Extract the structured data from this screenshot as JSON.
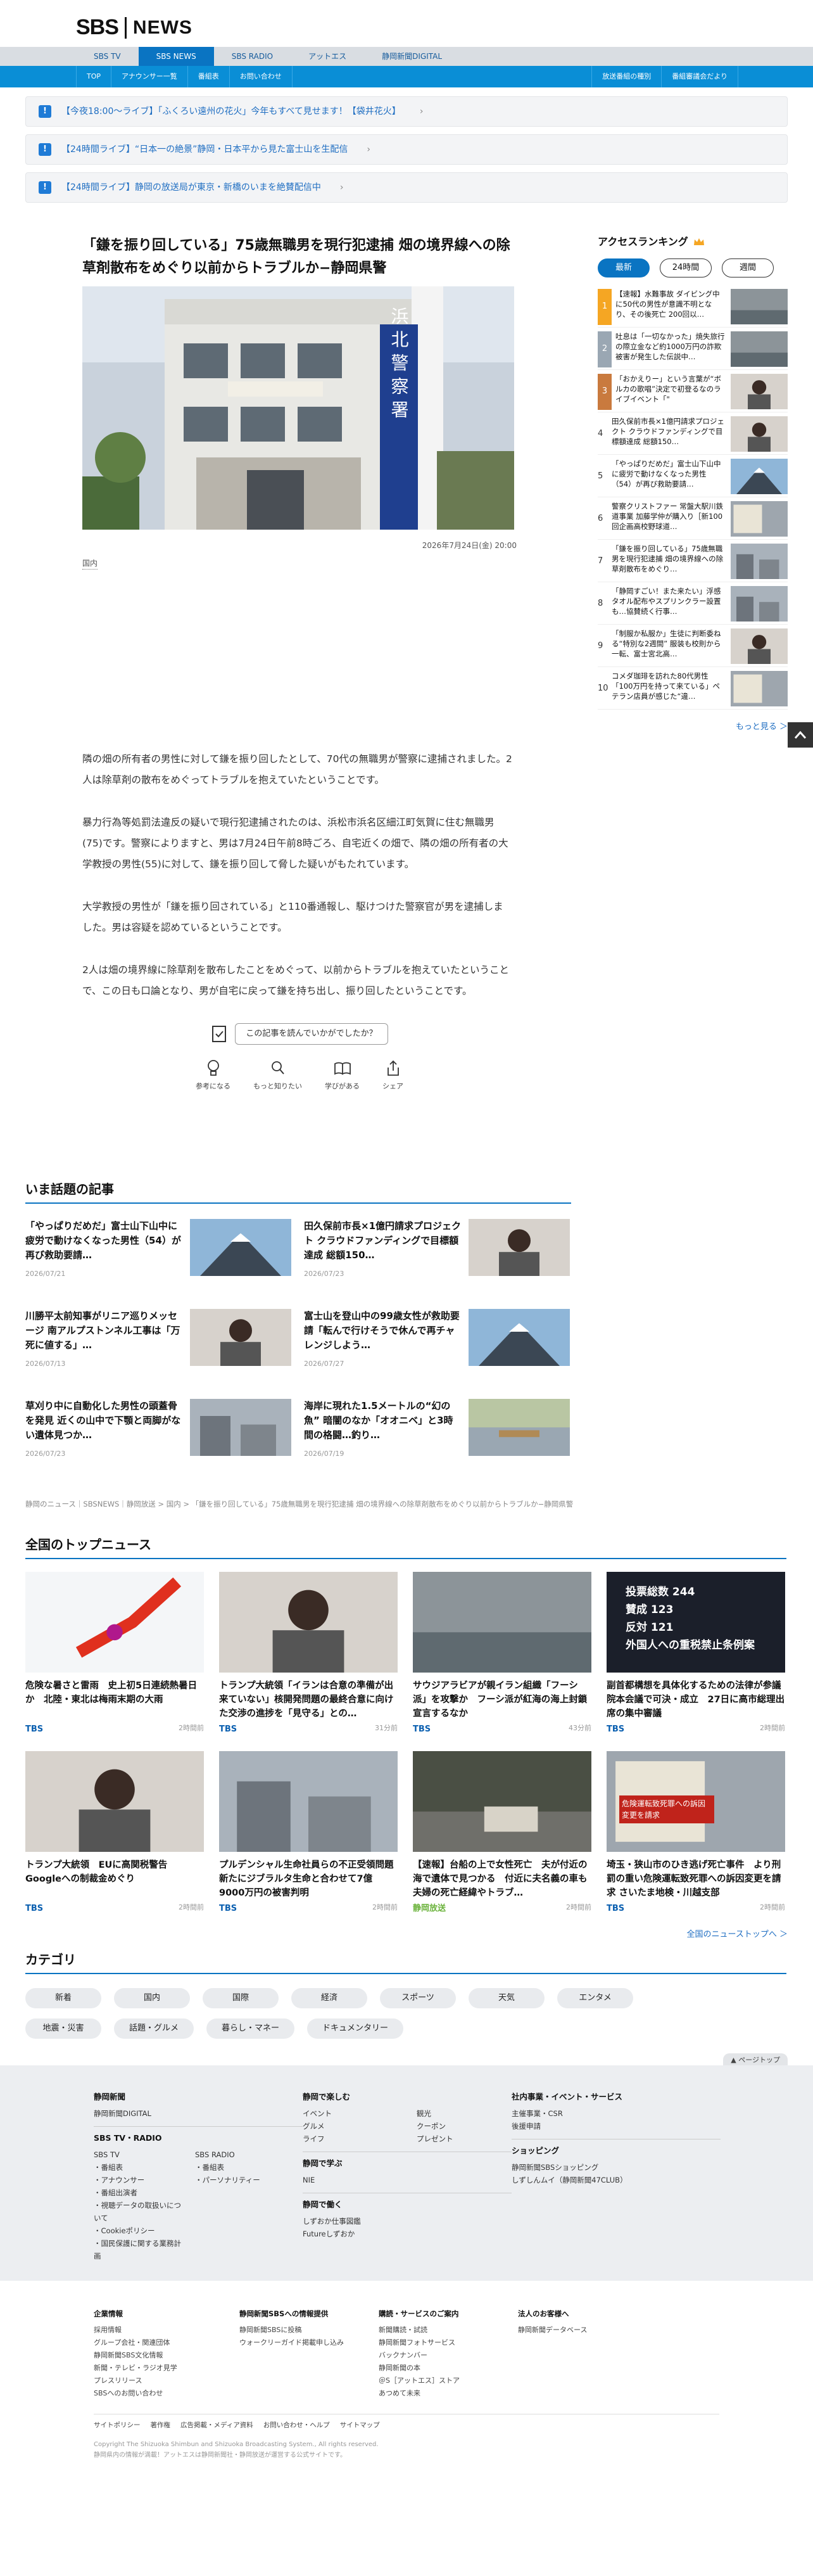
{
  "header": {
    "logo_sbs": "SBS",
    "logo_news": "NEWS"
  },
  "topnav": [
    "SBS TV",
    "SBS NEWS",
    "SBS RADIO",
    "アットエス",
    "静岡新聞DIGITAL"
  ],
  "subnav": {
    "left": [
      "TOP",
      "アナウンサー一覧",
      "番組表",
      "お問い合わせ"
    ],
    "right": [
      "放送番組の種別",
      "番組審議会だより"
    ]
  },
  "alerts": [
    "【今夜18:00〜ライブ】「ふくろい遠州の花火」今年もすべて見せます！【袋井花火】",
    "【24時間ライブ】“日本一の絶景”静岡・日本平から見た富士山を生配信",
    "【24時間ライブ】静岡の放送局が東京・新橋のいまを絶賛配信中"
  ],
  "article": {
    "title": "「鎌を振り回している」75歳無職男を現行犯逮捕 畑の境界線への除草剤散布をめぐり以前からトラブルか−静岡県警",
    "building_sign": "浜 北 警 察 署",
    "date": "2026年7月24日(金) 20:00",
    "category": "国内",
    "paragraphs": [
      "隣の畑の所有者の男性に対して鎌を振り回したとして、70代の無職男が警察に逮捕されました。2人は除草剤の散布をめぐってトラブルを抱えていたということです。",
      "暴力行為等処罰法違反の疑いで現行犯逮捕されたのは、浜松市浜名区細江町気賀に住む無職男(75)です。警察によりますと、男は7月24日午前8時ごろ、自宅近くの畑で、隣の畑の所有者の大学教授の男性(55)に対して、鎌を振り回して脅した疑いがもたれています。",
      "大学教授の男性が「鎌を振り回されている」と110番通報し、駆けつけた警察官が男を逮捕しました。男は容疑を認めているということです。",
      "2人は畑の境界線に除草剤を散布したことをめぐって、以前からトラブルを抱えていたということで、この日も口論となり、男が自宅に戻って鎌を持ち出し、振り回したということです。"
    ],
    "feedback_question": "この記事を読んでいかがでしたか？",
    "feedback_options": [
      "参考になる",
      "もっと知りたい",
      "学びがある",
      "シェア"
    ]
  },
  "ranking": {
    "title": "アクセスランキング",
    "tabs": [
      "最新",
      "24時間",
      "週間"
    ],
    "items": [
      {
        "num": "1",
        "text": "【速報】水難事故 ダイビング中に50代の男性が意識不明となり、その後死亡 200回以…"
      },
      {
        "num": "2",
        "text": "吐息は「一切なかった」焼失旅行の際立金など約1000万円の詐欺被害が発生した伝説中…"
      },
      {
        "num": "3",
        "text": "「おかえりー」という言葉が“ボルカの歌唱”決定で初登るなのライブイベント「\""
      },
      {
        "num": "4",
        "text": "田久保前市長×1億円請求プロジェクト クラウドファンディングで目標額達成 総額150…"
      },
      {
        "num": "5",
        "text": "「やっぱりだめだ」富士山下山中に疲労で動けなくなった男性（54）が再び救助要請…"
      },
      {
        "num": "6",
        "text": "警察クリストファー 常盤大駅川鉄道事業 加藤学仲が購入り［新100回企画高校野球道…"
      },
      {
        "num": "7",
        "text": "「鎌を振り回している」75歳無職男を現行犯逮捕 畑の境界線への除草剤散布をめぐり…"
      },
      {
        "num": "8",
        "text": "「静岡すごい！また来たい」浮感タオル配布やスプリンクラー設置も…協賛続く行事…"
      },
      {
        "num": "9",
        "text": "「制服か私服か」生徒に判断委ねる“特別な2週間” 服装も校則から一転、富士宮北高…"
      },
      {
        "num": "10",
        "text": "コメダ珈琲を訪れた80代男性「100万円を持って来ている」ペテラン店員が感じた“違…"
      }
    ],
    "more": "もっと見る ＞"
  },
  "trending": {
    "title": "いま話題の記事",
    "items": [
      {
        "title": "「やっぱりだめだ」富士山下山中に疲労で動けなくなった男性（54）が再び救助要請…",
        "date": "2026/07/21"
      },
      {
        "title": "田久保前市長×1億円請求プロジェクト クラウドファンディングで目標額達成 総額150…",
        "date": "2026/07/23"
      },
      {
        "title": "川勝平太前知事がリニア巡りメッセージ 南アルプストンネル工事は「万死に値する」…",
        "date": "2026/07/13"
      },
      {
        "title": "富士山を登山中の99歳女性が救助要請「転んで行けそうで休んで再チャレンジしよう…",
        "date": "2026/07/27"
      },
      {
        "title": "草刈り中に自動化した男性の頭蓋骨を発見 近くの山中で下顎と両脚がない遺体見つか…",
        "date": "2026/07/23"
      },
      {
        "title": "海岸に現れた1.5メートルの“幻の魚” 暗闇のなか「オオニベ」と3時間の格闘…釣り…",
        "date": "2026/07/19"
      }
    ]
  },
  "breadcrumb": "静岡のニュース｜SBSNEWS｜静岡放送 > 国内 > 「鎌を振り回している」75歳無職男を現行犯逮捕 畑の境界線への除草剤散布をめぐり以前からトラブルか−静岡県警",
  "top_news": {
    "title": "全国のトップニュース",
    "items": [
      {
        "title": "危険な暑さと雷雨　史上初5日連続熱暑日か　北陸・東北は梅雨末期の大雨",
        "src": "TBS",
        "time": "2時間前"
      },
      {
        "title": "トランプ大統領「イランは合意の準備が出来ていない」核開発問題の最終合意に向けた交渉の進捗を「見守る」との…",
        "src": "TBS",
        "time": "31分前"
      },
      {
        "title": "サウジアラビアが親イラン組織「フーシ派」を攻撃か　フーシ派が紅海の海上封鎖宣言するなか",
        "src": "TBS",
        "time": "43分前"
      },
      {
        "title": "副首都構想を具体化するための法律が参議院本会議で可決・成立　27日に高市総理出席の集中審議",
        "src": "TBS",
        "time": "2時間前"
      },
      {
        "title": "トランプ大統領　EUに高関税警告　Googleへの制裁金めぐり",
        "src": "TBS",
        "time": "2時間前"
      },
      {
        "title": "プルデンシャル生命社員らの不正受領問題　新たにジブラルタ生命と合わせて7億9000万円の被害判明",
        "src": "TBS",
        "time": "2時間前"
      },
      {
        "title": "【速報】台船の上で女性死亡　夫が付近の海で遺体で見つかる　付近に夫名義の車も　夫婦の死亡経緯やトラブ…",
        "src": "静岡放送",
        "time": "2時間前"
      },
      {
        "title": "埼玉・狭山市のひき逃げ死亡事件　より刑罰の重い危険運転致死罪への訴因変更を請求 さいたま地検・川越支部",
        "src": "TBS",
        "time": "2時間前"
      }
    ],
    "vote_lines": [
      "投票総数 244",
      "賛成 123",
      "反対 121",
      "外国人への重税禁止条例案"
    ],
    "sign_text": "危険運転致死罪への訴因変更を請求",
    "more": "全国のニューストップへ ＞"
  },
  "categories": {
    "title": "カテゴリ",
    "items": [
      "新着",
      "国内",
      "国際",
      "経済",
      "スポーツ",
      "天気",
      "エンタメ",
      "地震・災害",
      "話題・グルメ",
      "暮らし・マネー",
      "ドキュメンタリー"
    ]
  },
  "page_top": "▲ ページトップ",
  "footer": {
    "col1": {
      "h1": "静岡新聞",
      "l1": [
        "静岡新聞DIGITAL"
      ],
      "h2": "SBS TV・RADIO",
      "tv": [
        "SBS TV",
        "・番組表",
        "・アナウンサー",
        "・番組出演者",
        "・視聴データの取扱いについて",
        "・Cookieポリシー",
        "・国民保護に関する業務計画"
      ],
      "radio": [
        "SBS RADIO",
        "・番組表",
        "・パーソナリティー"
      ]
    },
    "col2": {
      "h1": "静岡で楽しむ",
      "l1a": [
        "イベント",
        "グルメ",
        "ライフ"
      ],
      "l1b": [
        "観光",
        "クーポン",
        "プレゼント"
      ],
      "h2": "静岡で学ぶ",
      "l2": [
        "NIE"
      ],
      "h3": "静岡で働く",
      "l3": [
        "しずおか仕事図鑑",
        "Futureしずおか"
      ]
    },
    "col3": {
      "h1": "社内事業・イベント・サービス",
      "l1": [
        "主催事業・CSR",
        "後援申請"
      ],
      "h2": "ショッピング",
      "l2": [
        "静岡新聞SBSショッピング",
        "しずしんムイ（静岡新聞47CLUB）"
      ]
    },
    "row2": [
      {
        "h": "企業情報",
        "l": [
          "採用情報",
          "グループ会社・関連団体",
          "静岡新聞SBS文化情報",
          "新聞・テレビ・ラジオ見学",
          "プレスリリース",
          "SBSへのお問い合わせ"
        ]
      },
      {
        "h": "静岡新聞SBSへの情報提供",
        "l": [
          "静岡新聞SBSに投稿",
          "ウォークリーガイド掲載申し込み"
        ]
      },
      {
        "h": "購読・サービスのご案内",
        "l": [
          "新聞購読・試読",
          "静岡新聞フォトサービス",
          "バックナンバー",
          "静岡新聞の本",
          "＠S［アットエス］ストア",
          "あつめて未来"
        ]
      },
      {
        "h": "法人のお客様へ",
        "l": [
          "静岡新聞データベース"
        ]
      }
    ],
    "bottom_links": [
      "サイトポリシー",
      "著作権",
      "広告掲載・メディア資料",
      "お問い合わせ・ヘルプ",
      "サイトマップ"
    ],
    "copyright": "Copyright The Shizuoka Shimbun and Shizuoka Broadcasting System., All rights reserved.",
    "copyright2": "静岡県内の情報が満載！アットエスは静岡新聞社・静岡放送が運営する公式サイトです。"
  },
  "colors": {
    "brand_blue": "#0a74c2",
    "nav_blue": "#0a8ed6",
    "link_blue": "#1f6ec2",
    "rank_accent": "#f5a623"
  }
}
